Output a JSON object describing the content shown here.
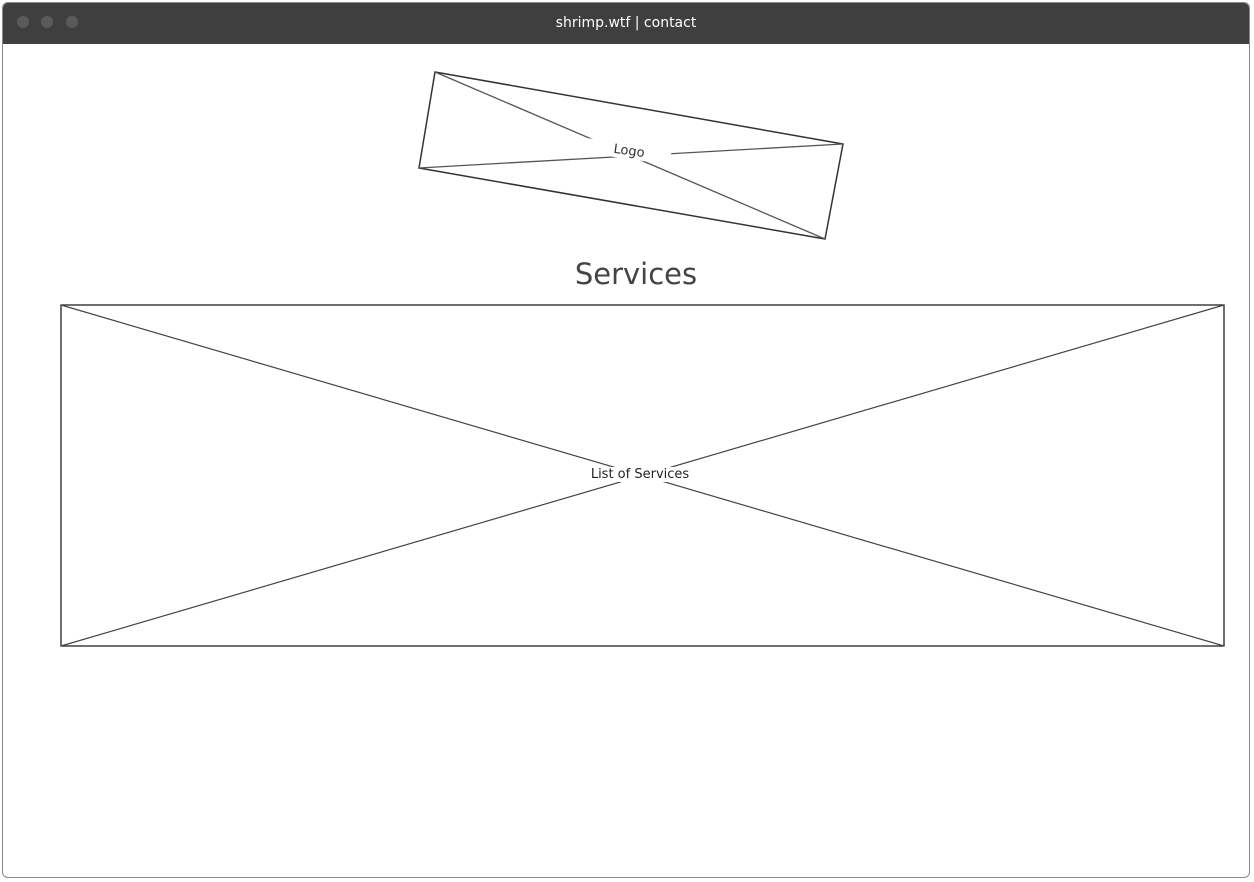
{
  "window": {
    "title": "shrimp.wtf | contact"
  },
  "logo": {
    "label": "Logo"
  },
  "services": {
    "heading": "Services",
    "placeholder_label": "List of Services"
  }
}
